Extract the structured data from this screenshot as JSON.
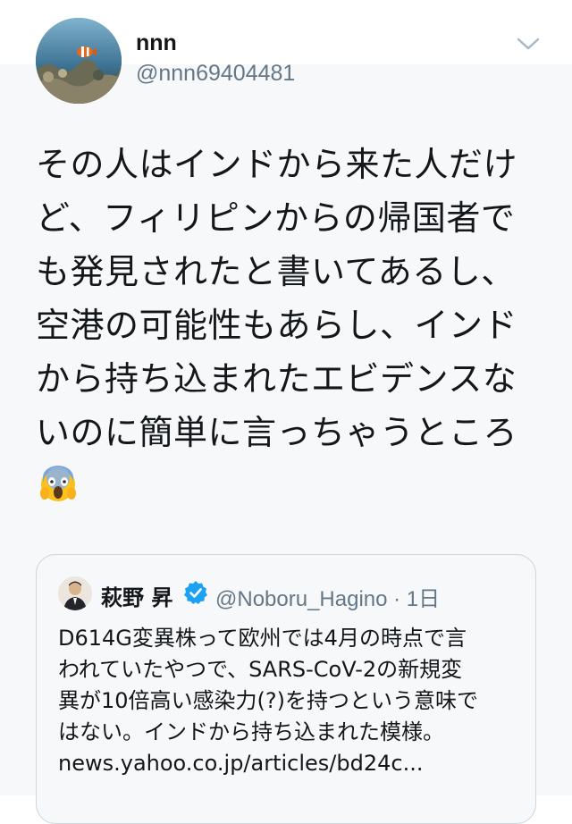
{
  "author": {
    "display_name": "nnn",
    "handle": "@nnn69404481"
  },
  "menu_icon": "chevron-down-icon",
  "tweet": {
    "text": "その人はインドから来た人だけ\nど、フィリピンからの帰国者で\nも発見されたと書いてあるし、\n空港の可能性もあらし、インド\nから持ち込まれたエビデンスな\nいのに簡単に言っちゃうところ",
    "emoji": "face-screaming-in-fear"
  },
  "quoted_tweet": {
    "display_name": "萩野 昇",
    "verified_icon": "verified-badge-icon",
    "handle_and_time": "@Noboru_Hagino · 1日",
    "text": "D614G変異株って欧州では4月の時点で言\nわれていたやつで、SARS-CoV-2の新規変\n異が10倍高い感染力(?)を持つという意味で\nはない。インドから持ち込まれた模様。\nnews.yahoo.co.jp/articles/bd24c..."
  },
  "colors": {
    "background": "#f6f8fa",
    "text": "#14171a",
    "secondary": "#657786",
    "border": "#ccd6dd",
    "verified": "#1da1f2"
  }
}
